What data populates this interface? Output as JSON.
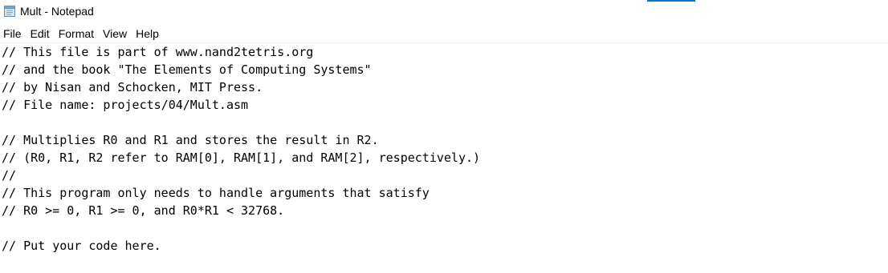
{
  "window": {
    "title": "Mult - Notepad",
    "app_icon": "notepad-icon",
    "accent_color": "#0078d7"
  },
  "menu": {
    "items": [
      "File",
      "Edit",
      "Format",
      "View",
      "Help"
    ]
  },
  "editor": {
    "lines": [
      "// This file is part of www.nand2tetris.org",
      "// and the book \"The Elements of Computing Systems\"",
      "// by Nisan and Schocken, MIT Press.",
      "// File name: projects/04/Mult.asm",
      "",
      "// Multiplies R0 and R1 and stores the result in R2.",
      "// (R0, R1, R2 refer to RAM[0], RAM[1], and RAM[2], respectively.)",
      "//",
      "// This program only needs to handle arguments that satisfy",
      "// R0 >= 0, R1 >= 0, and R0*R1 < 32768.",
      "",
      "// Put your code here."
    ]
  }
}
